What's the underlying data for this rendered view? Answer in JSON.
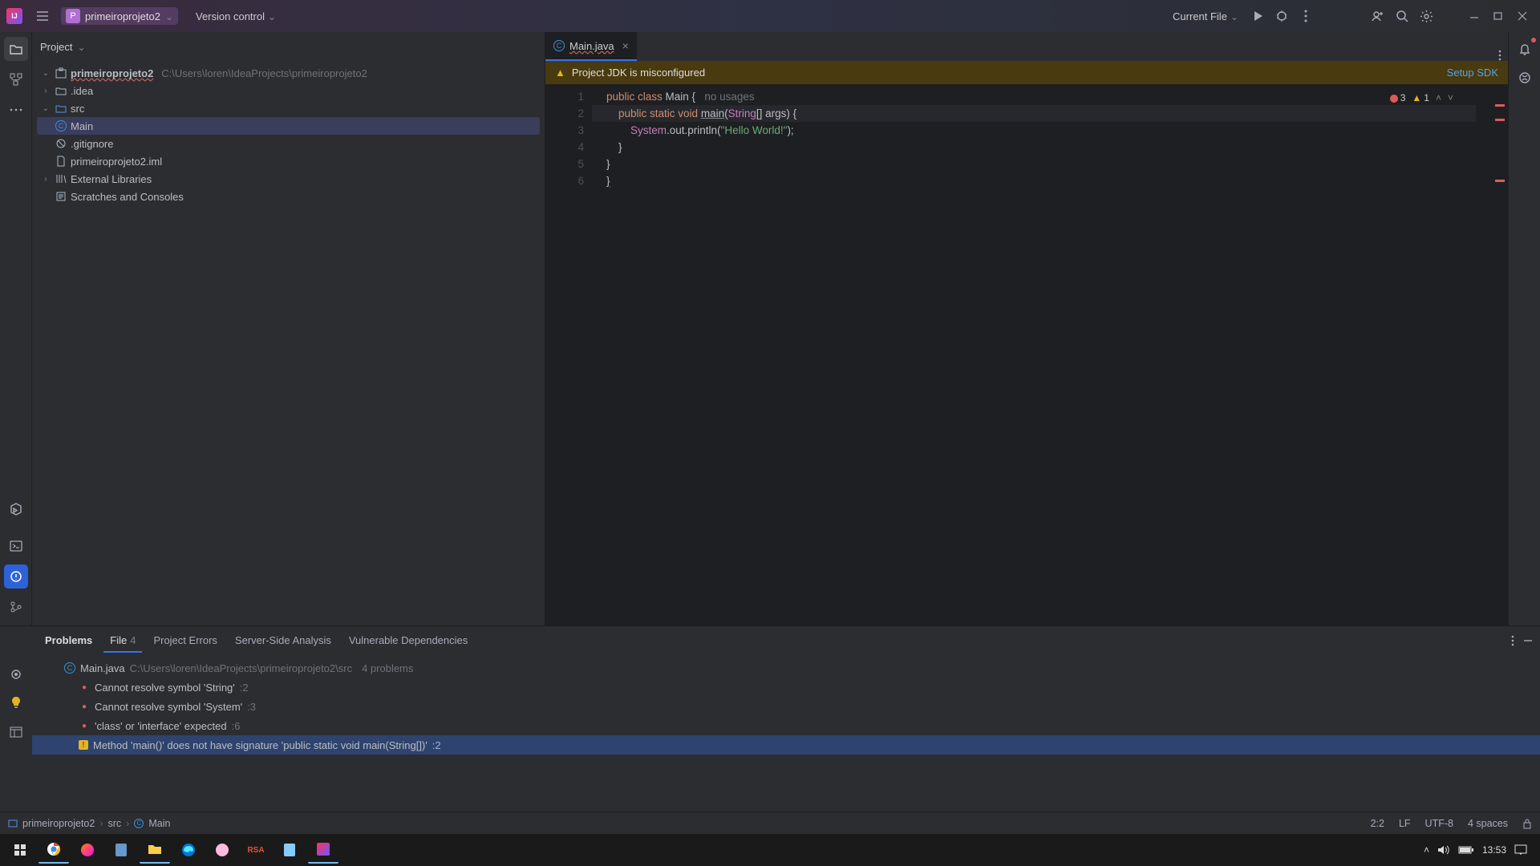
{
  "titlebar": {
    "project_name": "primeiroprojeto2",
    "version_control": "Version control",
    "current_file": "Current File"
  },
  "project_panel": {
    "title": "Project",
    "root_name": "primeiroprojeto2",
    "root_path": "C:\\Users\\loren\\IdeaProjects\\primeiroprojeto2",
    "idea": ".idea",
    "src": "src",
    "main": "Main",
    "gitignore": ".gitignore",
    "iml": "primeiroprojeto2.iml",
    "ext_lib": "External Libraries",
    "scratches": "Scratches and Consoles"
  },
  "editor": {
    "tab_name": "Main.java",
    "sdk_warning": "Project JDK is misconfigured",
    "sdk_link": "Setup SDK",
    "errors": "3",
    "warnings": "1",
    "no_usages": "no usages",
    "code": {
      "l1a": "public ",
      "l1b": "class ",
      "l1c": "Main {",
      "l2a": "    public static void ",
      "l2b": "main",
      "l2c": "(",
      "l2d": "String",
      "l2e": "[] args) {",
      "l3a": "        ",
      "l3b": "System",
      "l3c": ".out.println(",
      "l3d": "\"Hello World!\"",
      "l3e": ");",
      "l4": "    }",
      "l5": "}",
      "l6": "}"
    },
    "lines": [
      "1",
      "2",
      "3",
      "4",
      "5",
      "6"
    ]
  },
  "problems": {
    "title": "Problems",
    "tabs": {
      "file": "File",
      "file_count": "4",
      "errors": "Project Errors",
      "server": "Server-Side Analysis",
      "vuln": "Vulnerable Dependencies"
    },
    "file_name": "Main.java",
    "file_path": "C:\\Users\\loren\\IdeaProjects\\primeiroprojeto2\\src",
    "file_count_text": "4 problems",
    "items": [
      {
        "text": "Cannot resolve symbol 'String'",
        "loc": ":2",
        "type": "err"
      },
      {
        "text": "Cannot resolve symbol 'System'",
        "loc": ":3",
        "type": "err"
      },
      {
        "text": "'class' or 'interface' expected",
        "loc": ":6",
        "type": "err"
      },
      {
        "text": "Method 'main()' does not have signature 'public static void main(String[])'",
        "loc": ":2",
        "type": "wrn"
      }
    ]
  },
  "breadcrumb": {
    "p1": "primeiroprojeto2",
    "p2": "src",
    "p3": "Main",
    "pos": "2:2",
    "lf": "LF",
    "enc": "UTF-8",
    "indent": "4 spaces"
  },
  "taskbar": {
    "time": "13:53"
  }
}
